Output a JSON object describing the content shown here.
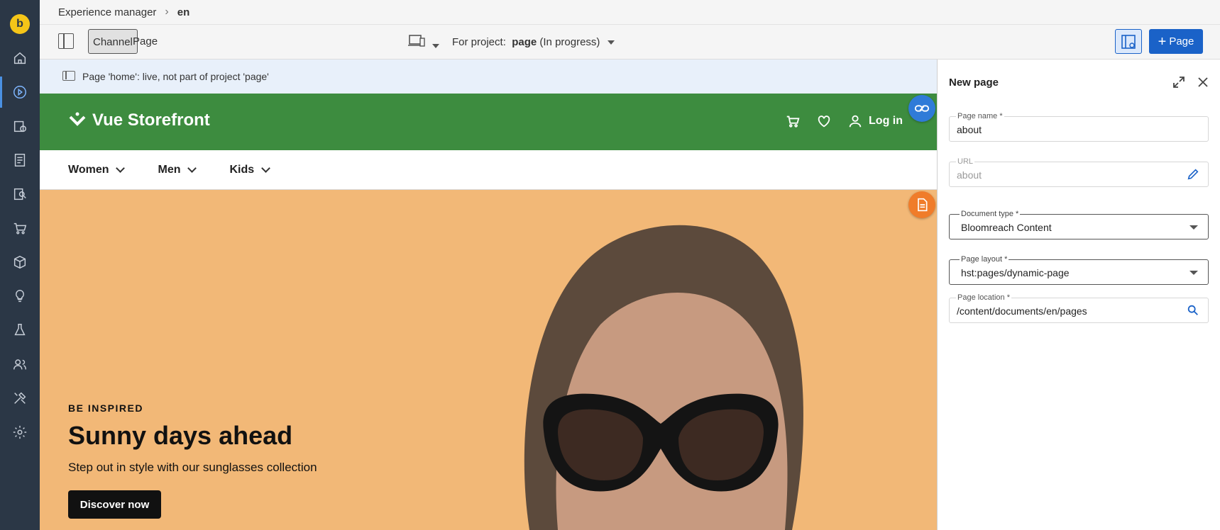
{
  "breadcrumb": {
    "root": "Experience manager",
    "current": "en"
  },
  "toolbar": {
    "tab_channel": "Channel",
    "tab_page": "Page",
    "project_prefix": "For project:",
    "project_name": "page",
    "project_status": "(In progress)",
    "add_page_label": "Page"
  },
  "info": {
    "message": "Page 'home': live, not part of project 'page'"
  },
  "site": {
    "brand": "Vue Storefront",
    "login": "Log in",
    "nav": [
      "Women",
      "Men",
      "Kids"
    ],
    "hero": {
      "tag": "BE INSPIRED",
      "title": "Sunny days ahead",
      "subtitle": "Step out in style with our sunglasses collection",
      "cta": "Discover now"
    }
  },
  "panel": {
    "title": "New page",
    "fields": {
      "page_name": {
        "label": "Page name *",
        "value": "about"
      },
      "url": {
        "label": "URL",
        "value": "about"
      },
      "document_type": {
        "label": "Document type *",
        "value": "Bloomreach Content"
      },
      "page_layout": {
        "label": "Page layout *",
        "value": "hst:pages/dynamic-page"
      },
      "page_location": {
        "label": "Page location *",
        "value": "/content/documents/en/pages"
      }
    }
  },
  "colors": {
    "rail": "#2b3746",
    "header_green": "#3d8c3f",
    "hero_bg": "#f2b877",
    "primary": "#1a62c8",
    "info_bg": "#e8f0fa"
  }
}
